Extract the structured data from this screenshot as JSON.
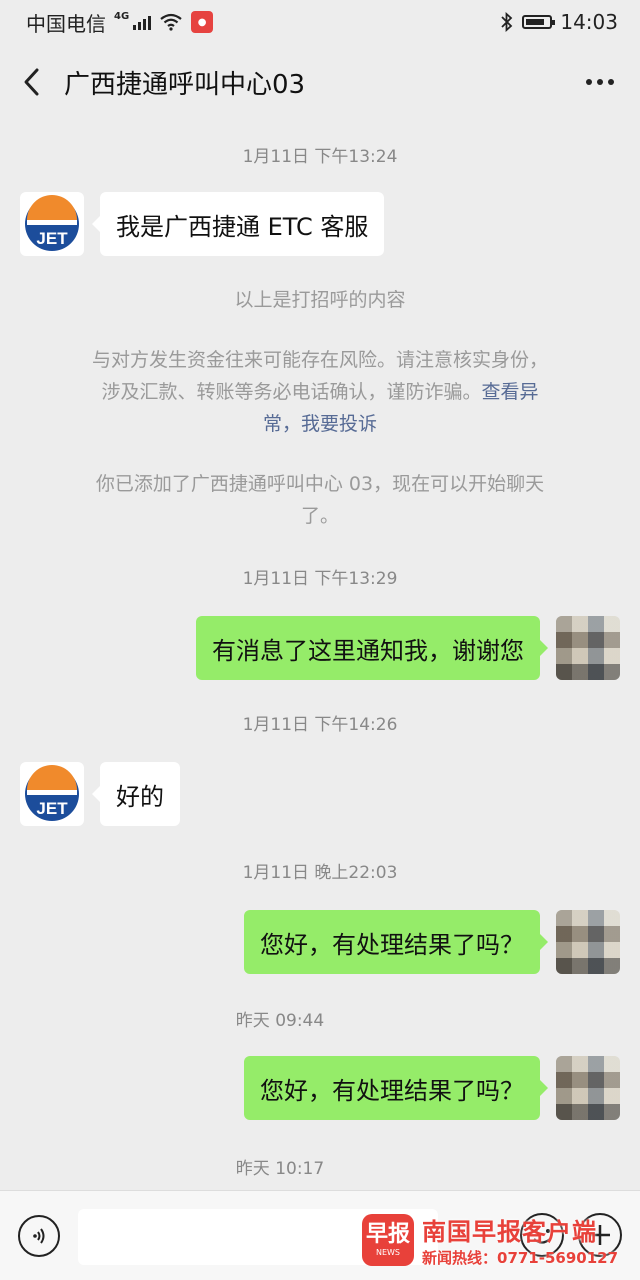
{
  "status_bar": {
    "carrier": "中国电信",
    "network": "4G",
    "time": "14:03",
    "battery_level": 0.8
  },
  "header": {
    "title": "广西捷通呼叫中心03"
  },
  "chat": {
    "timestamps": [
      "1月11日 下午13:24",
      "1月11日 下午13:29",
      "1月11日 下午14:26",
      "1月11日 晚上22:03",
      "昨天 09:44",
      "昨天 10:17"
    ],
    "messages": [
      {
        "sender": "contact",
        "text": "我是广西捷通 ETC 客服"
      },
      {
        "sender": "me",
        "text": "有消息了这里通知我，谢谢您"
      },
      {
        "sender": "contact",
        "text": "好的"
      },
      {
        "sender": "me",
        "text": "您好，有处理结果了吗？"
      },
      {
        "sender": "me",
        "text": "您好，有处理结果了吗？"
      }
    ],
    "system": {
      "greeting_note": "以上是打招呼的内容",
      "risk_warning_line1": "与对方发生资金往来可能存在风险。请注意核实身份，",
      "risk_warning_line2": "涉及汇款、转账等务必电话确认，谨防诈骗。",
      "risk_link_part1": "查看异",
      "risk_link_part2": "常，我要投诉",
      "added_line1": "你已添加了广西捷通呼叫中心 03，现在可以开始聊天",
      "added_line2": "了。"
    },
    "contact_avatar_text": "JET"
  },
  "input_bar": {
    "placeholder": ""
  },
  "watermark": {
    "logo_text": "早报",
    "logo_sub": "NEWS",
    "title": "南国早报客户端",
    "hotline": "新闻热线：0771-5690127"
  },
  "colors": {
    "background": "#ededed",
    "outgoing_bubble": "#95ec69",
    "incoming_bubble": "#ffffff",
    "link": "#576b95",
    "watermark_red": "#e8413a"
  }
}
